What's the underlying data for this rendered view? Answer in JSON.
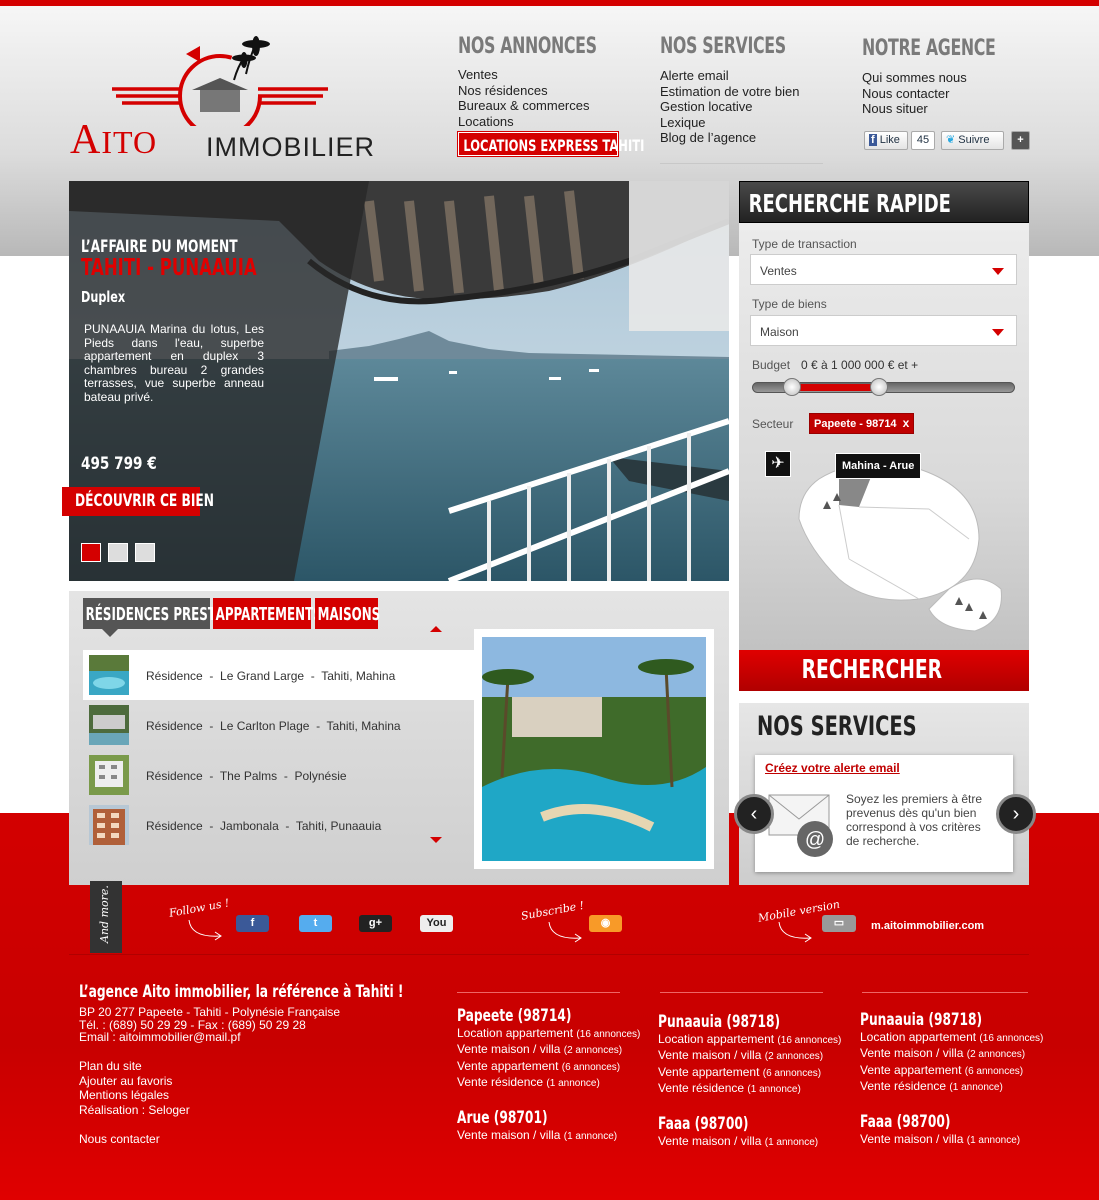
{
  "brand": {
    "logo_main": "AITO",
    "logo_sub": "IMMOBILIER"
  },
  "nav": {
    "annonces": {
      "title": "NOS ANNONCES",
      "items": [
        "Ventes",
        "Nos résidences",
        "Bureaux & commerces",
        "Locations"
      ],
      "express": "LOCATIONS EXPRESS TAHITI"
    },
    "services": {
      "title": "NOS SERVICES",
      "items": [
        "Alerte email",
        "Estimation de votre bien",
        "Gestion locative",
        "Lexique",
        "Blog de l’agence"
      ]
    },
    "agence": {
      "title": "NOTRE AGENCE",
      "items": [
        "Qui sommes nous",
        "Nous contacter",
        "Nous situer"
      ]
    }
  },
  "social_top": {
    "like": "Like",
    "like_count": "45",
    "follow": "Suivre",
    "plus": "+"
  },
  "hero": {
    "kicker": "L’AFFAIRE DU MOMENT",
    "place": "TAHITI - PUNAAUIA",
    "type": "Duplex",
    "description": "PUNAAUIA Marina du lotus, Les Pieds dans l'eau, superbe appartement en duplex 3 chambres bureau 2 grandes terrasses, vue superbe anneau bateau privé.",
    "price": "495 799 €",
    "cta": "DÉCOUVRIR CE BIEN",
    "slides": 3,
    "active_slide": 0
  },
  "search": {
    "title": "RECHERCHE RAPIDE",
    "transaction_label": "Type de transaction",
    "transaction_value": "Ventes",
    "bien_label": "Type de biens",
    "bien_value": "Maison",
    "budget_label": "Budget",
    "budget_value": "0 € à 1 000 000 € et +",
    "budget_min_fraction": 0.15,
    "budget_max_fraction": 0.48,
    "secteur_label": "Secteur",
    "secteur_tag": "Papeete - 98714",
    "secteur_remove": "x",
    "map_tooltip": "Mahina - Arue",
    "button": "RECHERCHER"
  },
  "residences": {
    "tabs": [
      "RÉSIDENCES PRESTIGE",
      "APPARTEMENTS",
      "MAISONS"
    ],
    "active_tab": 0,
    "items": [
      {
        "label": "Résidence  -  Le Grand Large  -  Tahiti, Mahina"
      },
      {
        "label": "Résidence  -  Le Carlton Plage  -  Tahiti, Mahina"
      },
      {
        "label": "Résidence  -  The Palms  -  Polynésie"
      },
      {
        "label": "Résidence  -  Jambonala  -  Tahiti, Punaauia"
      }
    ]
  },
  "services_box": {
    "title": "NOS SERVICES",
    "link": "Créez votre alerte email",
    "text": "Soyez les premiers à être prevenus dès qu'un bien correspond à vos critères de recherche."
  },
  "band": {
    "andmore": "And more.",
    "follow": "Follow us !",
    "subscribe": "Subscribe !",
    "mobile": "Mobile version",
    "mobile_url": "m.aitoimmobilier.com",
    "youtube": "You",
    "gplus": "g+"
  },
  "footer": {
    "title": "L’agence Aito immobilier, la référence à Tahiti !",
    "address": [
      "BP 20 277 Papeete - Tahiti - Polynésie Française",
      "Tél. : (689) 50 29 29 - Fax : (689) 50 29 28",
      "Email : aitoimmobilier@mail.pf"
    ],
    "links": [
      "Plan du site",
      "Ajouter au favoris",
      "Mentions légales",
      "Réalisation : Seloger",
      "",
      "Nous contacter"
    ],
    "columns": [
      {
        "title": "Papeete (98714)",
        "items": [
          [
            "Location appartement",
            "(16 annonces)"
          ],
          [
            "Vente maison / villa",
            "(2 annonces)"
          ],
          [
            "Vente appartement",
            "(6 annonces)"
          ],
          [
            "Vente résidence",
            "(1 annonce)"
          ]
        ]
      },
      {
        "title": "Punaauia (98718)",
        "items": [
          [
            "Location appartement",
            "(16 annonces)"
          ],
          [
            "Vente maison / villa",
            "(2 annonces)"
          ],
          [
            "Vente appartement",
            "(6 annonces)"
          ],
          [
            "Vente résidence",
            "(1 annonce)"
          ]
        ]
      },
      {
        "title": "Punaauia (98718)",
        "items": [
          [
            "Location appartement",
            "(16 annonces)"
          ],
          [
            "Vente maison / villa",
            "(2 annonces)"
          ],
          [
            "Vente appartement",
            "(6 annonces)"
          ],
          [
            "Vente résidence",
            "(1 annonce)"
          ]
        ]
      },
      {
        "title": "Arue (98701)",
        "items": [
          [
            "Vente maison / villa",
            "(1 annonce)"
          ]
        ]
      },
      {
        "title": "Faaa (98700)",
        "items": [
          [
            "Vente maison / villa",
            "(1 annonce)"
          ]
        ]
      },
      {
        "title": "Faaa (98700)",
        "items": [
          [
            "Vente maison / villa",
            "(1 annonce)"
          ]
        ]
      }
    ]
  },
  "colors": {
    "accent": "#d40000",
    "dark": "#2a2a2a"
  }
}
